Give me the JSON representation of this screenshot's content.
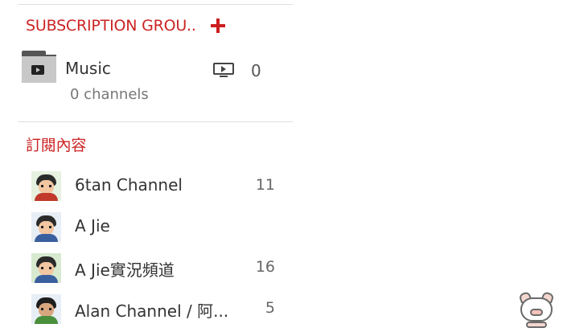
{
  "subscription_groups": {
    "title": "SUBSCRIPTION GROU..",
    "add_icon": "plus-icon",
    "groups": [
      {
        "name": "Music",
        "subtitle": "0 channels",
        "count": "0",
        "icon": "folder-play-icon"
      }
    ]
  },
  "subscriptions": {
    "title": "訂閱內容",
    "channels": [
      {
        "name": "6tan Channel",
        "count": "11"
      },
      {
        "name": "A Jie",
        "count": ""
      },
      {
        "name": "A Jie實況頻道",
        "count": "16"
      },
      {
        "name": "Alan Channel / 阿...",
        "count": "5"
      }
    ]
  },
  "colors": {
    "accent": "#cc2424",
    "text": "#333333",
    "muted": "#777777",
    "divider": "#e0e0e0"
  }
}
